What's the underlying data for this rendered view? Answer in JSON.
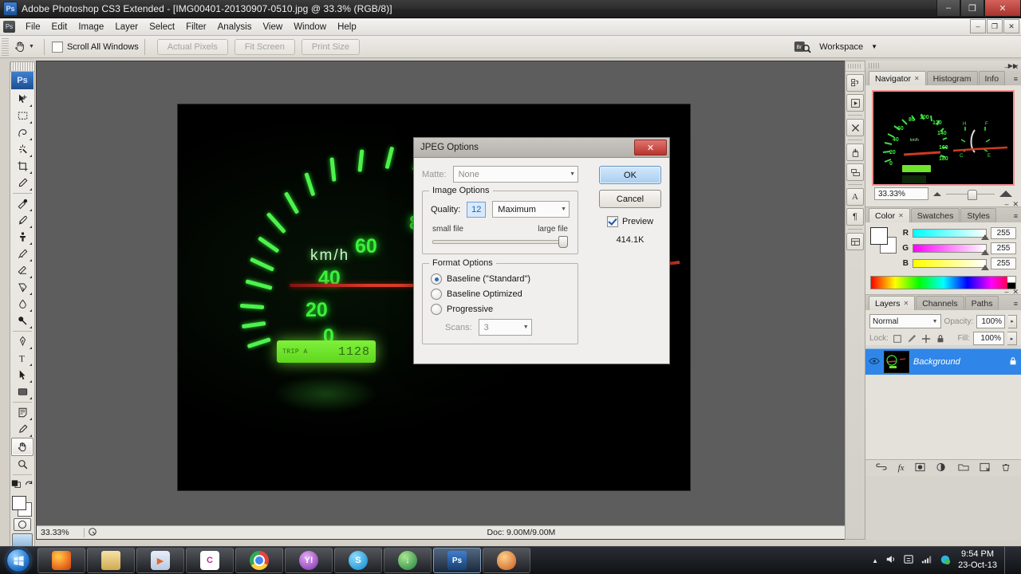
{
  "window": {
    "title": "Adobe Photoshop CS3 Extended - [IMG00401-20130907-0510.jpg @ 33.3% (RGB/8)]",
    "app_badge": "Ps",
    "minimize": "–",
    "maximize": "❐",
    "close": "✕"
  },
  "menubar": {
    "items": [
      "File",
      "Edit",
      "Image",
      "Layer",
      "Select",
      "Filter",
      "Analysis",
      "View",
      "Window",
      "Help"
    ],
    "doc_minimize": "–",
    "doc_restore": "❐",
    "doc_close": "✕"
  },
  "options_bar": {
    "tool_icon": "hand-tool-icon",
    "scroll_all_windows": "Scroll All Windows",
    "actual_pixels": "Actual Pixels",
    "fit_screen": "Fit Screen",
    "print_size": "Print Size",
    "workspace": "Workspace",
    "workspace_caret": "▼",
    "bridge_icon": "go-to-bridge-icon"
  },
  "toolbox": {
    "logo": "Ps",
    "tools": [
      {
        "name": "move-tool",
        "glyph": "✥"
      },
      {
        "name": "marquee-tool",
        "glyph": "⬚"
      },
      {
        "name": "lasso-tool",
        "glyph": "➦"
      },
      {
        "name": "magic-wand-tool",
        "glyph": "✳"
      },
      {
        "name": "crop-tool",
        "glyph": "⌗"
      },
      {
        "name": "eyedropper-slice-tool",
        "glyph": "✒"
      },
      {
        "name": "healing-brush-tool",
        "glyph": "✐"
      },
      {
        "name": "brush-tool",
        "glyph": "✏"
      },
      {
        "name": "clone-stamp-tool",
        "glyph": "⎙"
      },
      {
        "name": "history-brush-tool",
        "glyph": "⌘"
      },
      {
        "name": "eraser-tool",
        "glyph": "▱"
      },
      {
        "name": "gradient-tool",
        "glyph": "◧"
      },
      {
        "name": "blur-tool",
        "glyph": "●"
      },
      {
        "name": "dodge-tool",
        "glyph": "⚲"
      },
      {
        "name": "pen-tool",
        "glyph": "✒"
      },
      {
        "name": "type-tool",
        "glyph": "T"
      },
      {
        "name": "path-selection-tool",
        "glyph": "➤"
      },
      {
        "name": "rectangle-tool",
        "glyph": "▭"
      },
      {
        "name": "notes-tool",
        "glyph": "☰"
      },
      {
        "name": "color-sampler-tool",
        "glyph": "✐"
      },
      {
        "name": "hand-tool",
        "glyph": "✋",
        "selected": true
      },
      {
        "name": "zoom-tool",
        "glyph": "⌕"
      }
    ]
  },
  "document": {
    "zoom": "33.33%",
    "doc_size": "Doc: 9.00M/9.00M",
    "status_arrow": "▶",
    "image": {
      "name": "speedometer-photo",
      "unit_label": "km/h",
      "speed_numbers": [
        "0",
        "20",
        "40",
        "60",
        "80",
        "100",
        "120",
        "140",
        "16",
        "18"
      ],
      "lcd_label": "TRIP A",
      "lcd_value": "1128"
    }
  },
  "icon_dock": {
    "items": [
      {
        "name": "history-panel-icon",
        "glyph": "↺"
      },
      {
        "name": "actions-panel-icon",
        "glyph": "▶"
      },
      {
        "name": "tool-presets-panel-icon",
        "glyph": "✂"
      },
      {
        "name": "brushes-panel-icon",
        "glyph": "✒"
      },
      {
        "name": "clone-source-panel-icon",
        "glyph": "⎙"
      },
      {
        "name": "character-panel-icon",
        "glyph": "A"
      },
      {
        "name": "paragraph-panel-icon",
        "glyph": "¶"
      },
      {
        "name": "layer-comps-panel-icon",
        "glyph": "▤"
      }
    ]
  },
  "navigator_panel": {
    "tabs": [
      {
        "label": "Navigator",
        "active": true,
        "closable": true
      },
      {
        "label": "Histogram",
        "active": false,
        "closable": false
      },
      {
        "label": "Info",
        "active": false,
        "closable": false
      }
    ],
    "zoom_value": "33.33%",
    "minimize": "–",
    "close": "✕",
    "menu": "≡"
  },
  "color_panel": {
    "tabs": [
      {
        "label": "Color",
        "active": true,
        "closable": true
      },
      {
        "label": "Swatches",
        "active": false,
        "closable": false
      },
      {
        "label": "Styles",
        "active": false,
        "closable": false
      }
    ],
    "channels": [
      {
        "label": "R",
        "value": "255"
      },
      {
        "label": "G",
        "value": "255"
      },
      {
        "label": "B",
        "value": "255"
      }
    ],
    "minimize": "–",
    "close": "✕",
    "menu": "≡"
  },
  "layers_panel": {
    "tabs": [
      {
        "label": "Layers",
        "active": true,
        "closable": true
      },
      {
        "label": "Channels",
        "active": false,
        "closable": false
      },
      {
        "label": "Paths",
        "active": false,
        "closable": false
      }
    ],
    "blend_mode": "Normal",
    "opacity_label": "Opacity:",
    "opacity_value": "100%",
    "lock_label": "Lock:",
    "fill_label": "Fill:",
    "fill_value": "100%",
    "lock_icons": [
      {
        "name": "lock-transparent-pixels-icon",
        "glyph": "▣"
      },
      {
        "name": "lock-image-pixels-icon",
        "glyph": "✐"
      },
      {
        "name": "lock-position-icon",
        "glyph": "✛"
      },
      {
        "name": "lock-all-icon",
        "glyph": "🔒"
      }
    ],
    "layer": {
      "name": "Background",
      "eye_icon": "◉",
      "lock_icon": "🔒"
    },
    "footer_icons": [
      {
        "name": "link-layers-icon",
        "glyph": "⚭"
      },
      {
        "name": "layer-style-icon",
        "glyph": "fx"
      },
      {
        "name": "layer-mask-icon",
        "glyph": "▣"
      },
      {
        "name": "adjustment-layer-icon",
        "glyph": "◑"
      },
      {
        "name": "new-group-icon",
        "glyph": "▱"
      },
      {
        "name": "new-layer-icon",
        "glyph": "❐"
      },
      {
        "name": "delete-layer-icon",
        "glyph": "🗑"
      }
    ],
    "minimize": "–",
    "close": "✕",
    "menu": "≡"
  },
  "dialog": {
    "title": "JPEG Options",
    "close": "✕",
    "matte_label": "Matte:",
    "matte_value": "None",
    "image_options_title": "Image Options",
    "quality_label": "Quality:",
    "quality_value": "12",
    "quality_preset": "Maximum",
    "small_file": "small file",
    "large_file": "large file",
    "format_options_title": "Format Options",
    "format_choices": [
      {
        "label": "Baseline (\"Standard\")",
        "selected": true,
        "enabled": true
      },
      {
        "label": "Baseline Optimized",
        "selected": false,
        "enabled": true
      },
      {
        "label": "Progressive",
        "selected": false,
        "enabled": true
      }
    ],
    "scans_label": "Scans:",
    "scans_value": "3",
    "ok": "OK",
    "cancel": "Cancel",
    "preview": "Preview",
    "file_size": "414.1K"
  },
  "taskbar": {
    "start_glyph": "⊞",
    "items": [
      {
        "name": "taskbar-firefox",
        "glyph": "🦊",
        "color1": "#f5862a",
        "color2": "#c43d11",
        "active": false
      },
      {
        "name": "taskbar-explorer",
        "glyph": "🗁",
        "color1": "#f3d58a",
        "color2": "#d0a94e",
        "active": false
      },
      {
        "name": "taskbar-media-player",
        "glyph": "▶",
        "color1": "#4aa3dd",
        "color2": "#17558f",
        "active": false
      },
      {
        "name": "taskbar-camtasia",
        "glyph": "C",
        "color1": "#ffffff",
        "color2": "#e8e8e8",
        "active": false
      },
      {
        "name": "taskbar-chrome",
        "glyph": "◉",
        "color1": "#e8453c",
        "color2": "#ffcd40",
        "active": false
      },
      {
        "name": "taskbar-yahoo-messenger",
        "glyph": "Y!",
        "color1": "#b35fd4",
        "color2": "#7a2ea8",
        "active": false
      },
      {
        "name": "taskbar-skype",
        "glyph": "S",
        "color1": "#38b5f0",
        "color2": "#0d85c8",
        "active": false
      },
      {
        "name": "taskbar-download-manager",
        "glyph": "↓",
        "color1": "#63c94a",
        "color2": "#1f7d3f",
        "active": false
      },
      {
        "name": "taskbar-photoshop",
        "glyph": "Ps",
        "color1": "#3f7fd0",
        "color2": "#16406f",
        "active": true
      },
      {
        "name": "taskbar-paint",
        "glyph": "🎨",
        "color1": "#f2a33c",
        "color2": "#c45a1e",
        "active": false
      }
    ],
    "tray": {
      "show_hidden": "▲",
      "volume": "🔊",
      "action_center": "⚑",
      "network": "▆",
      "antivirus": "✦",
      "time": "9:54 PM",
      "date": "23-Oct-13"
    }
  }
}
